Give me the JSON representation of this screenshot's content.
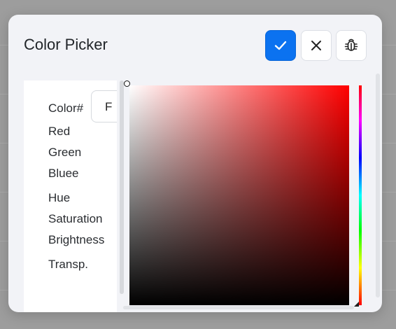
{
  "dialog": {
    "title": "Color Picker",
    "confirm_icon": "check-icon",
    "cancel_icon": "close-icon",
    "debug_icon": "bug-icon",
    "accent": "#0b72f0"
  },
  "fields": {
    "color_label": "Color#",
    "color_value": "F",
    "red_label": "Red",
    "green_label": "Green",
    "blue_label": "Bluee",
    "hue_label": "Hue",
    "saturation_label": "Saturation",
    "brightness_label": "Brightness",
    "transparency_label": "Transp."
  },
  "picker": {
    "base_hue_color": "#ff0000"
  }
}
